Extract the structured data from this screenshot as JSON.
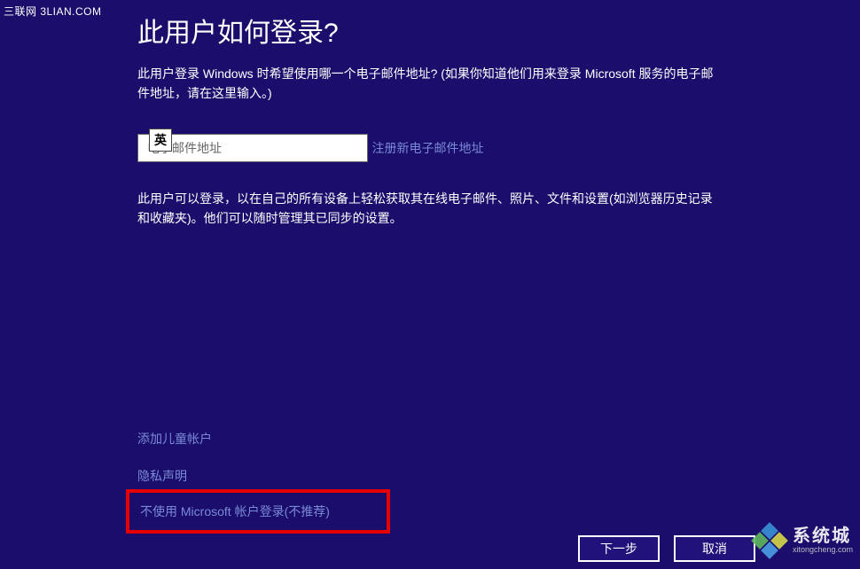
{
  "watermark": {
    "topleft": "三联网 3LIAN.COM",
    "bottomright_main": "系统城",
    "bottomright_sub": "xitongcheng.com"
  },
  "page": {
    "title": "此用户如何登录?",
    "description": "此用户登录 Windows 时希望使用哪一个电子邮件地址? (如果你知道他们用来登录 Microsoft 服务的电子邮件地址，请在这里输入。)",
    "description2": "此用户可以登录，以在自己的所有设备上轻松获取其在线电子邮件、照片、文件和设置(如浏览器历史记录和收藏夹)。他们可以随时管理其已同步的设置。"
  },
  "email": {
    "placeholder": "电子邮件地址",
    "value": ""
  },
  "ime": {
    "badge": "英"
  },
  "links": {
    "register_email": "注册新电子邮件地址",
    "add_child": "添加儿童帐户",
    "privacy": "隐私声明",
    "no_microsoft": "不使用 Microsoft 帐户登录(不推荐)"
  },
  "buttons": {
    "next": "下一步",
    "cancel": "取消"
  }
}
